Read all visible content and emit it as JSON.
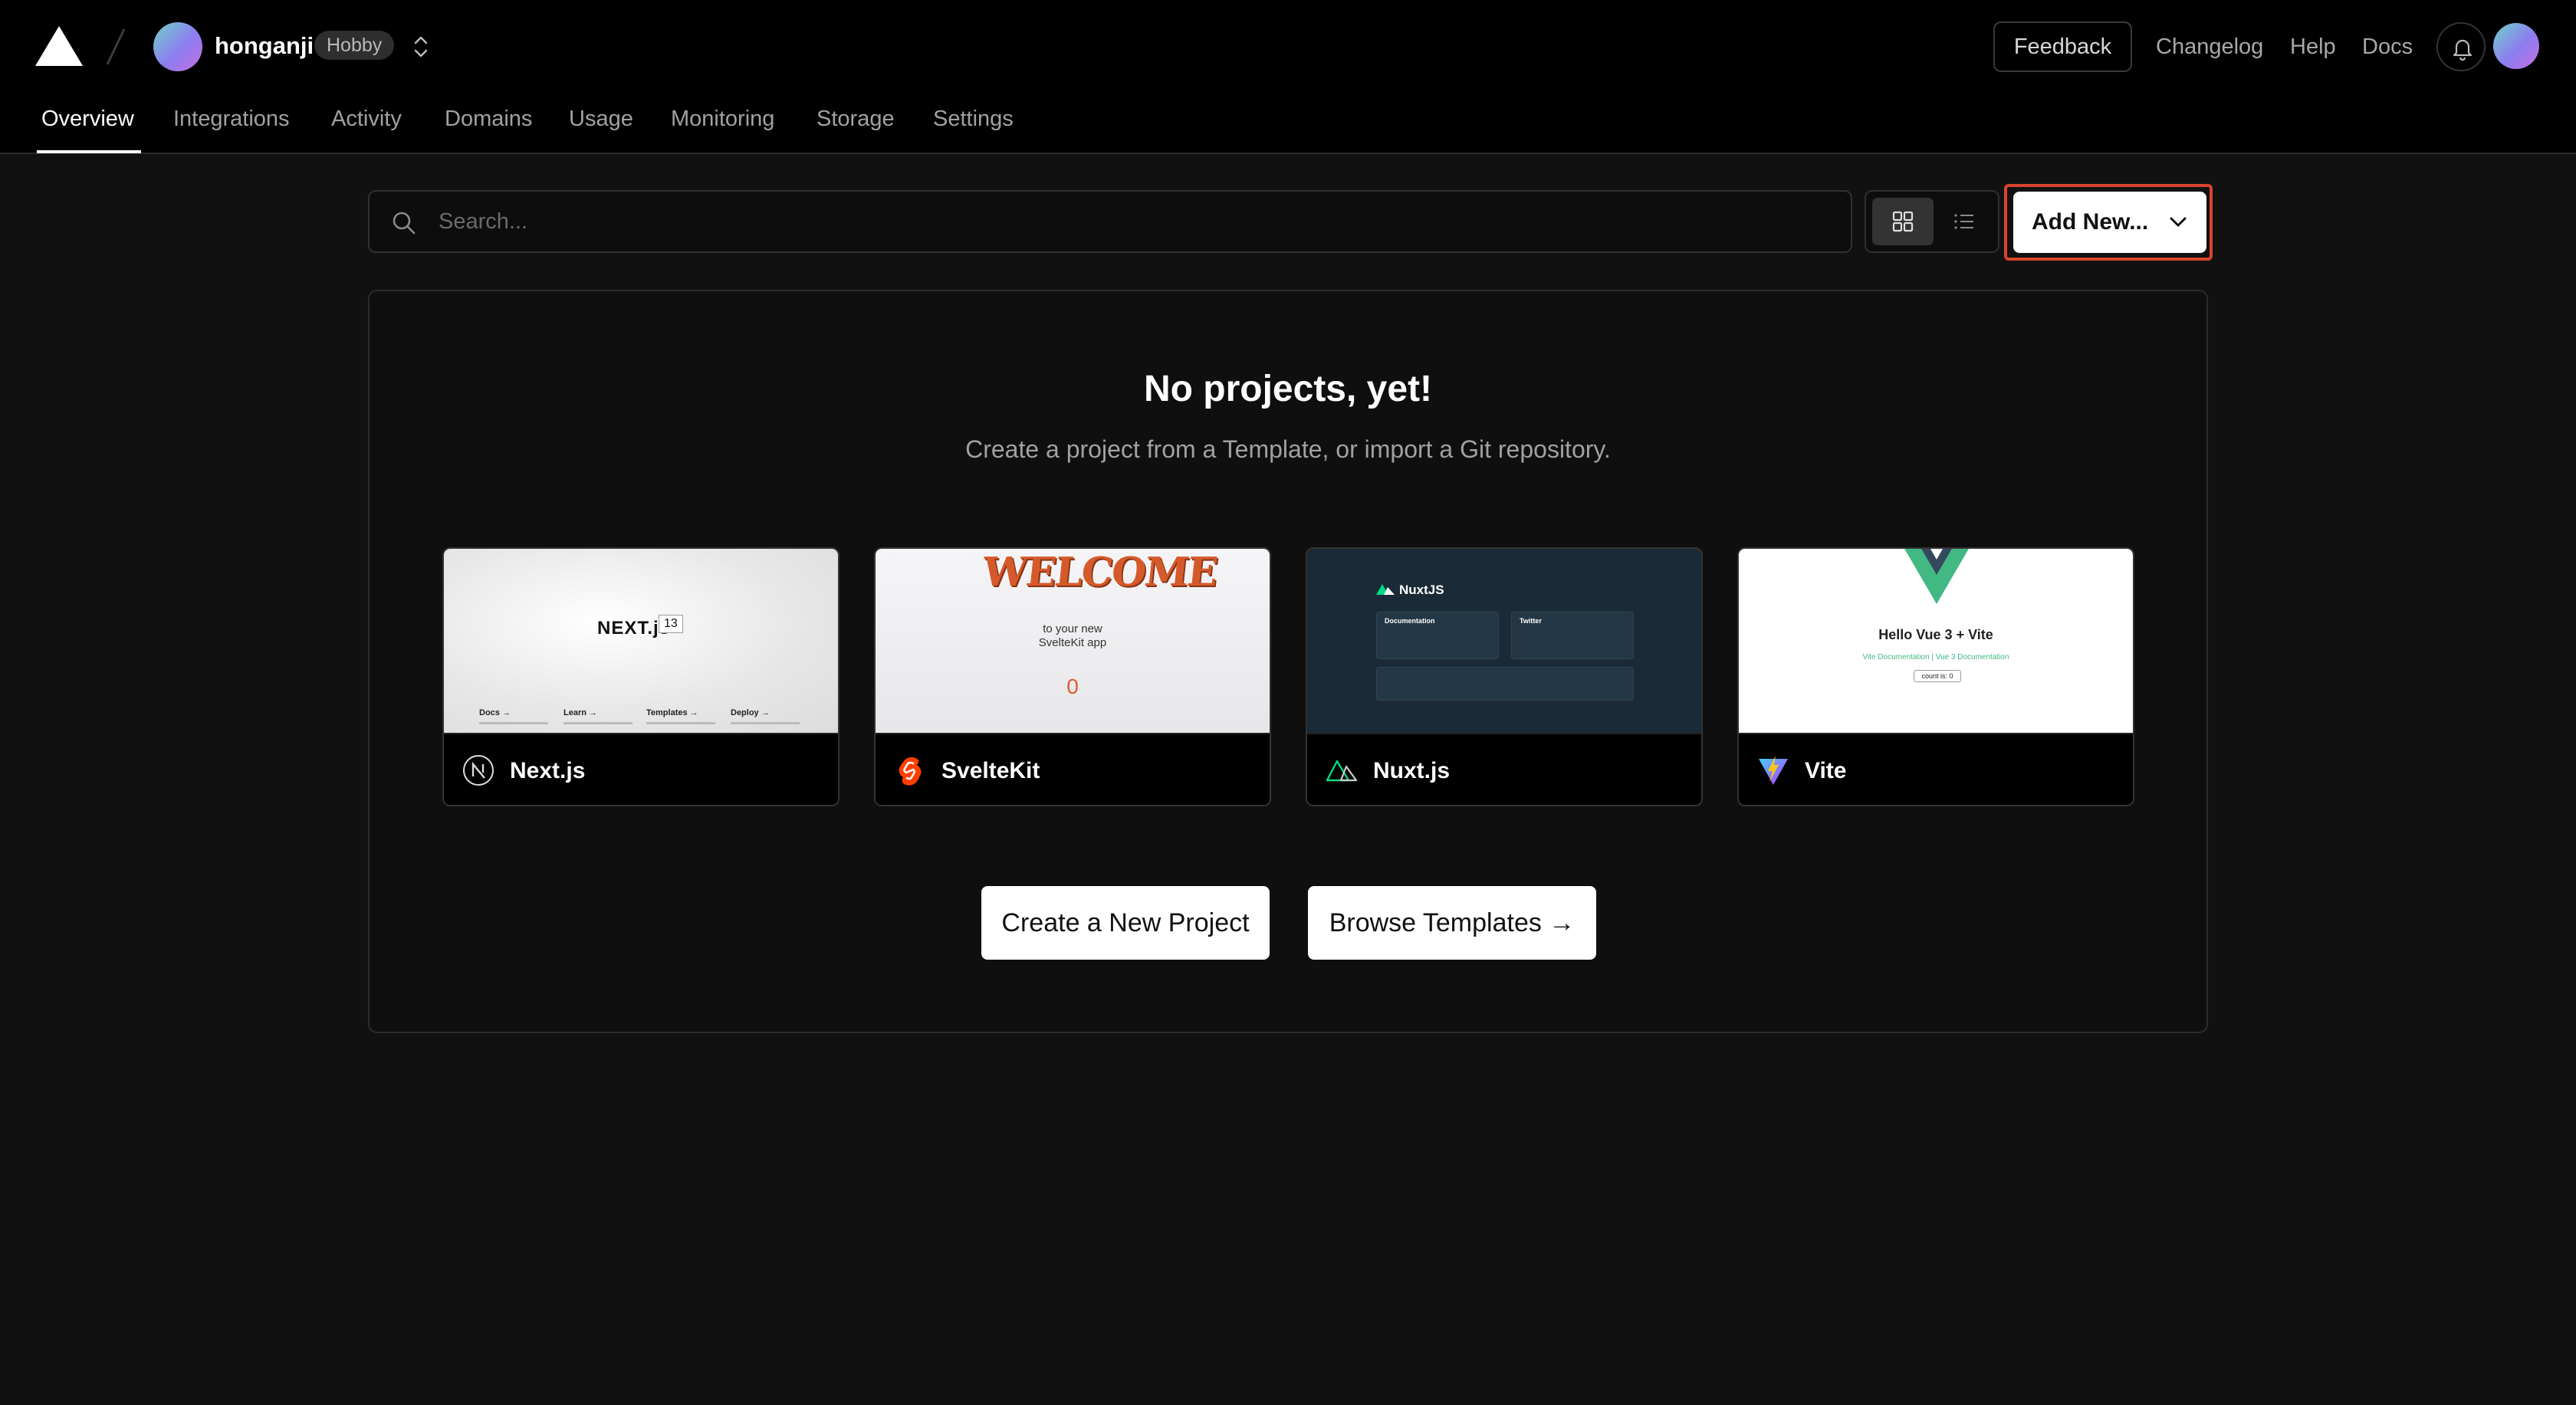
{
  "header": {
    "team_name": "honganji",
    "plan_badge": "Hobby",
    "feedback_label": "Feedback",
    "links": [
      "Changelog",
      "Help",
      "Docs"
    ]
  },
  "tabs": [
    "Overview",
    "Integrations",
    "Activity",
    "Domains",
    "Usage",
    "Monitoring",
    "Storage",
    "Settings"
  ],
  "active_tab": "Overview",
  "toolbar": {
    "search_placeholder": "Search...",
    "view_mode": "grid",
    "add_new_label": "Add New..."
  },
  "empty_state": {
    "title": "No projects, yet!",
    "subtitle": "Create a project from a Template, or import a Git repository."
  },
  "templates": [
    {
      "name": "Next.js",
      "icon": "nextjs-icon",
      "preview": {
        "wordmark": "NEXT.js",
        "version": "13",
        "links": [
          "Docs →",
          "Learn →",
          "Templates →",
          "Deploy →"
        ]
      }
    },
    {
      "name": "SvelteKit",
      "icon": "svelte-icon",
      "preview": {
        "headline": "WELCOME",
        "line1": "to your new",
        "line2": "SvelteKit app",
        "counter": "0"
      }
    },
    {
      "name": "Nuxt.js",
      "icon": "nuxt-icon",
      "preview": {
        "brand": "NuxtJS",
        "panel_left": "Documentation",
        "panel_right": "Twitter"
      }
    },
    {
      "name": "Vite",
      "icon": "vite-icon",
      "preview": {
        "title": "Hello Vue 3 + Vite",
        "links": "Vite Documentation | Vue 3 Documentation",
        "button": "count is: 0"
      }
    }
  ],
  "actions": {
    "create_label": "Create a New Project",
    "browse_label": "Browse Templates →"
  },
  "colors": {
    "background": "#111111",
    "header": "#000000",
    "highlight": "#d9432c",
    "accent_vue": "#42b883",
    "svelte": "#ff3e00"
  }
}
